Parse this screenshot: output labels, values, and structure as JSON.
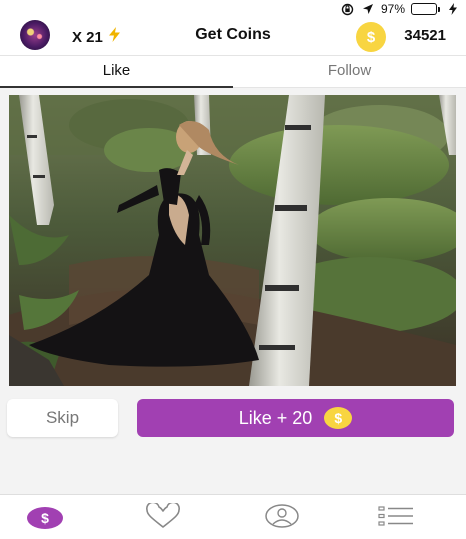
{
  "status_bar": {
    "battery_percent_label": "97%",
    "battery_level": 0.97,
    "icons": [
      "screen-rotation-lock-icon",
      "location-arrow-icon",
      "battery-icon",
      "charging-bolt-icon"
    ]
  },
  "header": {
    "multiplier": "X 21",
    "title": "Get Coins",
    "coin_symbol": "$",
    "coin_count": "34521",
    "icons": [
      "avatar",
      "lightning-bolt-icon",
      "coin-icon"
    ]
  },
  "tabs": [
    {
      "label": "Like",
      "active": true
    },
    {
      "label": "Follow",
      "active": false
    }
  ],
  "actions": {
    "skip_label": "Skip",
    "like_label": "Like + 20",
    "like_coin_symbol": "$"
  },
  "bottom_nav": {
    "coins_symbol": "$",
    "items": [
      "coins-icon",
      "heart-icon",
      "profile-icon",
      "list-icon"
    ]
  },
  "colors": {
    "accent": "#a140b2",
    "coin": "#f8d541",
    "battery": "#3cd35c",
    "bolt": "#f0b400"
  }
}
